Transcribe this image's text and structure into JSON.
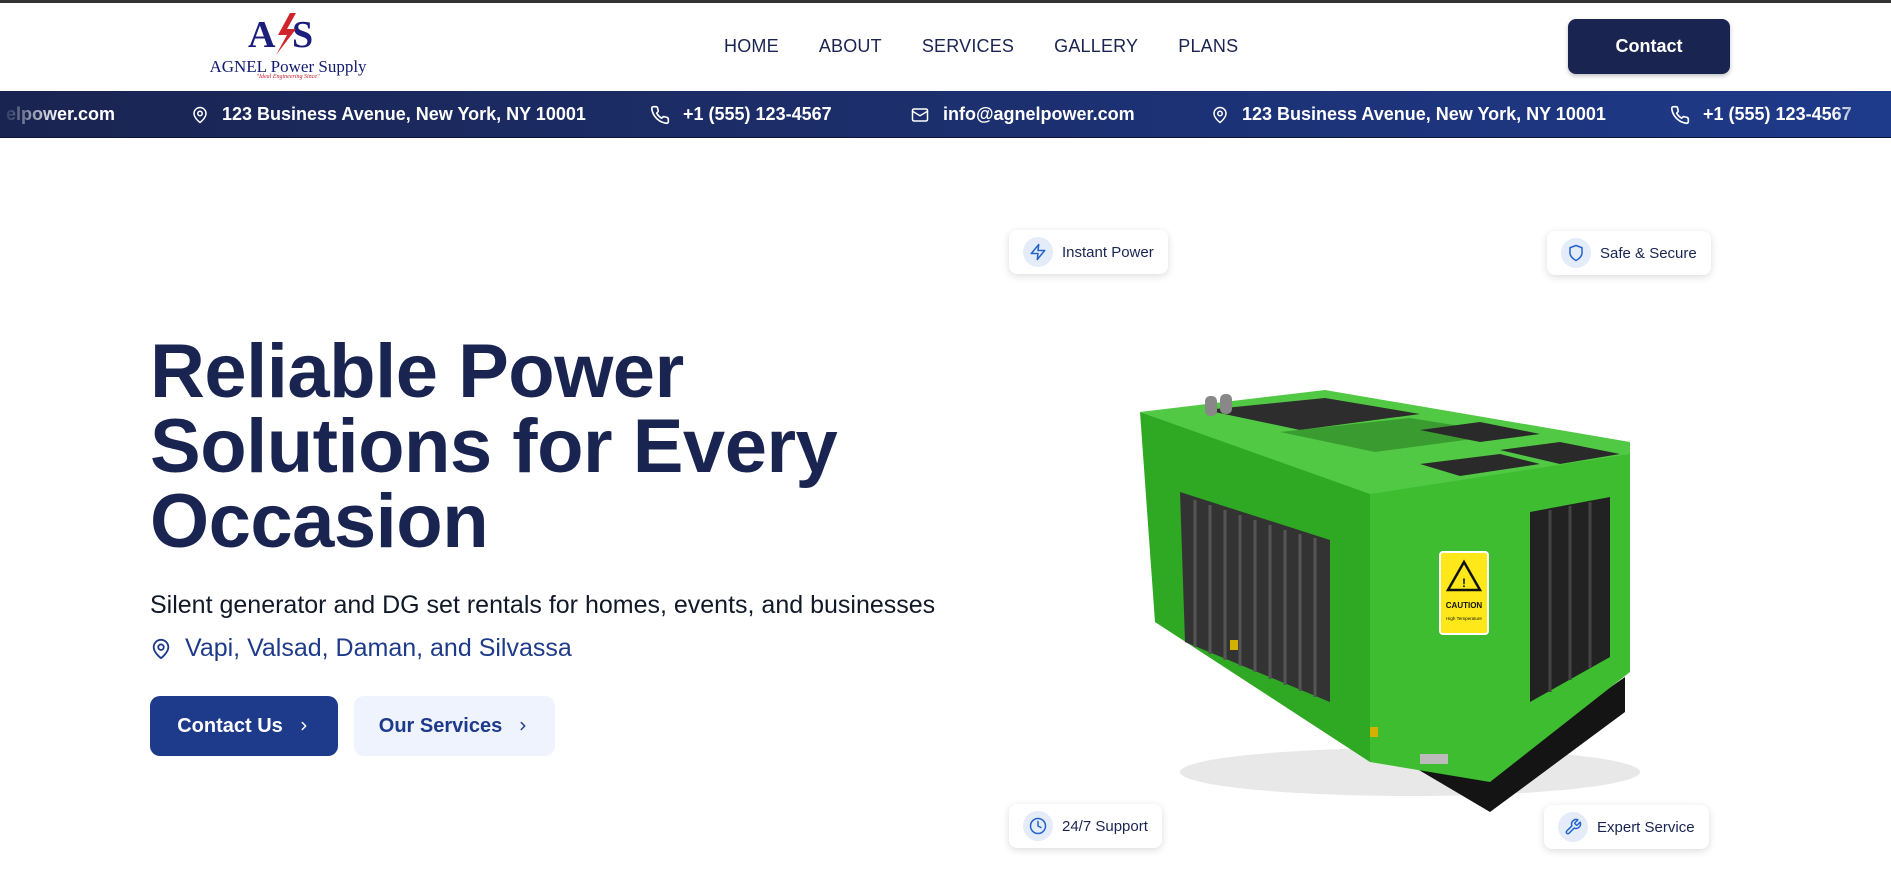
{
  "brand": {
    "logo_letters": "AS",
    "name": "AGNEL Power Supply",
    "tagline": "\"Ideal Engineering Since\""
  },
  "nav": {
    "items": [
      "HOME",
      "ABOUT",
      "SERVICES",
      "GALLERY",
      "PLANS"
    ],
    "contact_label": "Contact"
  },
  "infobar": {
    "email_partial": "elpower.com",
    "address": "123 Business Avenue, New York, NY 10001",
    "phone": "+1 (555) 123-4567",
    "email": "info@agnelpower.com"
  },
  "hero": {
    "title_line1": "Reliable Power",
    "title_line2": "Solutions for Every",
    "title_line3": "Occasion",
    "subtitle": "Silent generator and DG set rentals for homes, events, and businesses",
    "locations": "Vapi, Valsad, Daman, and Silvassa",
    "primary_button": "Contact Us",
    "secondary_button": "Our Services"
  },
  "badges": {
    "top_left": "Instant Power",
    "top_right": "Safe & Secure",
    "bottom_left": "24/7 Support",
    "bottom_right": "Expert Service"
  },
  "generator": {
    "sign_title": "CAUTION",
    "sign_text": "High Temperature"
  },
  "colors": {
    "navy": "#1a2451",
    "blue": "#1e3a8a",
    "light_blue": "#eef3fd",
    "generator_green": "#34b52a"
  },
  "icons": [
    "map-pin-icon",
    "phone-icon",
    "mail-icon",
    "lightning-icon",
    "shield-icon",
    "clock-icon",
    "wrench-icon",
    "chevron-right-icon"
  ]
}
